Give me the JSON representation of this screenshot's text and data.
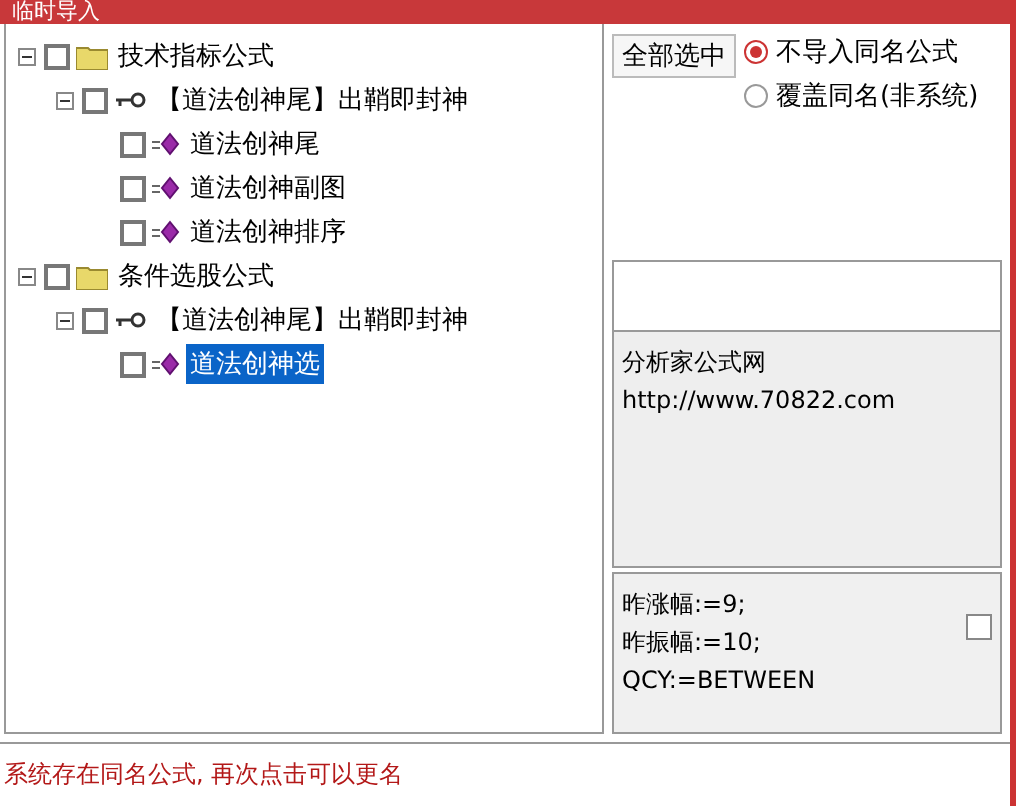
{
  "window": {
    "title": "临时导入"
  },
  "tree": [
    {
      "label": "技术指标公式",
      "kind": "folder",
      "checked": false,
      "selected": false,
      "expanded": true,
      "children": [
        {
          "label": "【道法创神尾】出鞘即封神",
          "kind": "group",
          "checked": false,
          "selected": false,
          "expanded": true,
          "children": [
            {
              "label": "道法创神尾",
              "kind": "formula",
              "checked": false,
              "selected": false
            },
            {
              "label": "道法创神副图",
              "kind": "formula",
              "checked": false,
              "selected": false
            },
            {
              "label": "道法创神排序",
              "kind": "formula",
              "checked": false,
              "selected": false
            }
          ]
        }
      ]
    },
    {
      "label": "条件选股公式",
      "kind": "folder",
      "checked": false,
      "selected": false,
      "expanded": true,
      "children": [
        {
          "label": "【道法创神尾】出鞘即封神",
          "kind": "group",
          "checked": false,
          "selected": false,
          "expanded": true,
          "children": [
            {
              "label": "道法创神选",
              "kind": "formula",
              "checked": false,
              "selected": true
            }
          ]
        }
      ]
    }
  ],
  "select_all_button": "全部选中",
  "options": [
    {
      "label": "不导入同名公式",
      "selected": true
    },
    {
      "label": "覆盖同名(非系统)",
      "selected": false
    }
  ],
  "info": [
    "分析家公式网",
    "http://www.70822.com"
  ],
  "code": {
    "lines": [
      "昨涨幅:=9;",
      "昨振幅:=10;",
      "QCY:=BETWEEN"
    ],
    "checked": false
  },
  "status": "系统存在同名公式, 再次点击可以更名"
}
